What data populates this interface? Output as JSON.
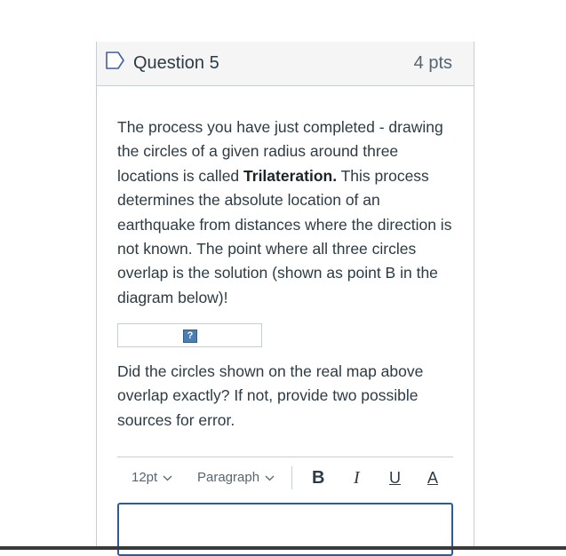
{
  "question": {
    "title": "Question 5",
    "points": "4 pts",
    "flag_icon": "bookmark-flag-icon",
    "paragraph_before": "The process you have just completed - drawing the circles of a given radius around three locations is called ",
    "bold_term": "Trilateration.",
    "paragraph_after": " This process determines the absolute location of an earthquake from distances where the direction is not known. The point where all three circles overlap is the solution (shown as point B in the diagram below)!",
    "image_icon": "broken-image-icon",
    "image_glyph": "?",
    "prompt": "Did the circles shown on the real map above overlap exactly? If not, provide two possible sources for error."
  },
  "editor": {
    "font_size": "12pt",
    "block_format": "Paragraph",
    "bold_label": "B",
    "italic_label": "I",
    "underline_label": "U",
    "text_color_label": "A",
    "value": ""
  },
  "colors": {
    "header_bg": "#f5f5f5",
    "border": "#c7cdd1",
    "text": "#2d3b45",
    "focus_border": "#2d5b9a",
    "broken_image": "#4a7fb3"
  }
}
